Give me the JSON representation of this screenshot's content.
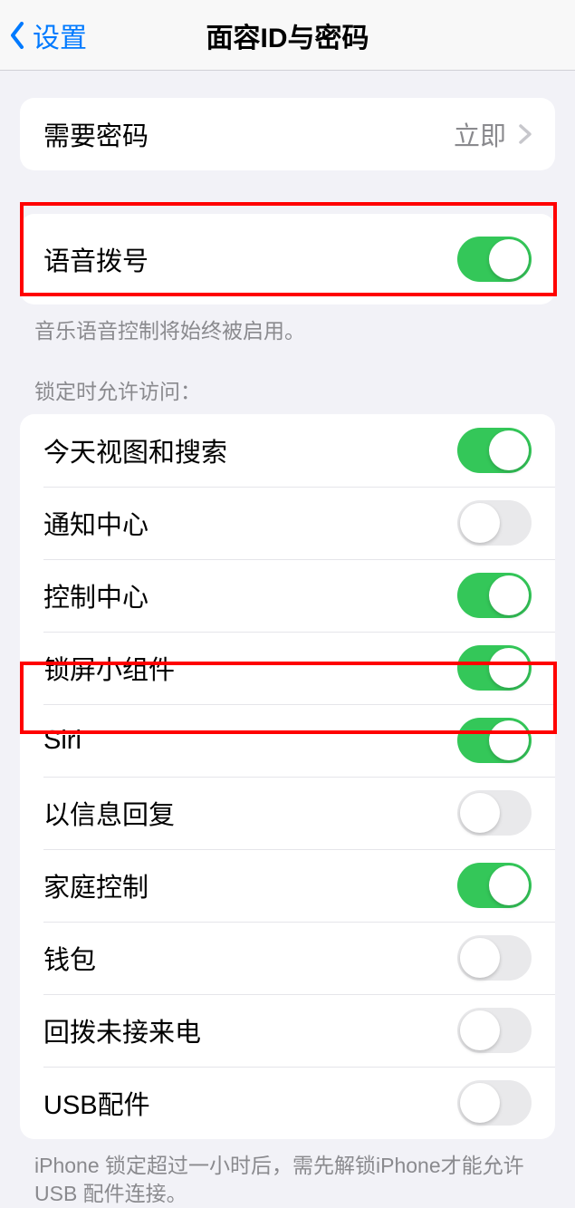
{
  "nav": {
    "back_label": "设置",
    "title": "面容ID与密码"
  },
  "require_passcode": {
    "label": "需要密码",
    "value": "立即"
  },
  "voice_dial": {
    "label": "语音拨号",
    "enabled": true,
    "footer": "音乐语音控制将始终被启用。"
  },
  "locked_access": {
    "header": "锁定时允许访问：",
    "items": [
      {
        "label": "今天视图和搜索",
        "enabled": true
      },
      {
        "label": "通知中心",
        "enabled": false
      },
      {
        "label": "控制中心",
        "enabled": true
      },
      {
        "label": "锁屏小组件",
        "enabled": true
      },
      {
        "label": "Siri",
        "enabled": true
      },
      {
        "label": "以信息回复",
        "enabled": false
      },
      {
        "label": "家庭控制",
        "enabled": true
      },
      {
        "label": "钱包",
        "enabled": false
      },
      {
        "label": "回拨未接来电",
        "enabled": false
      },
      {
        "label": "USB配件",
        "enabled": false
      }
    ],
    "footer": "iPhone 锁定超过一小时后，需先解锁iPhone才能允许USB 配件连接。"
  }
}
